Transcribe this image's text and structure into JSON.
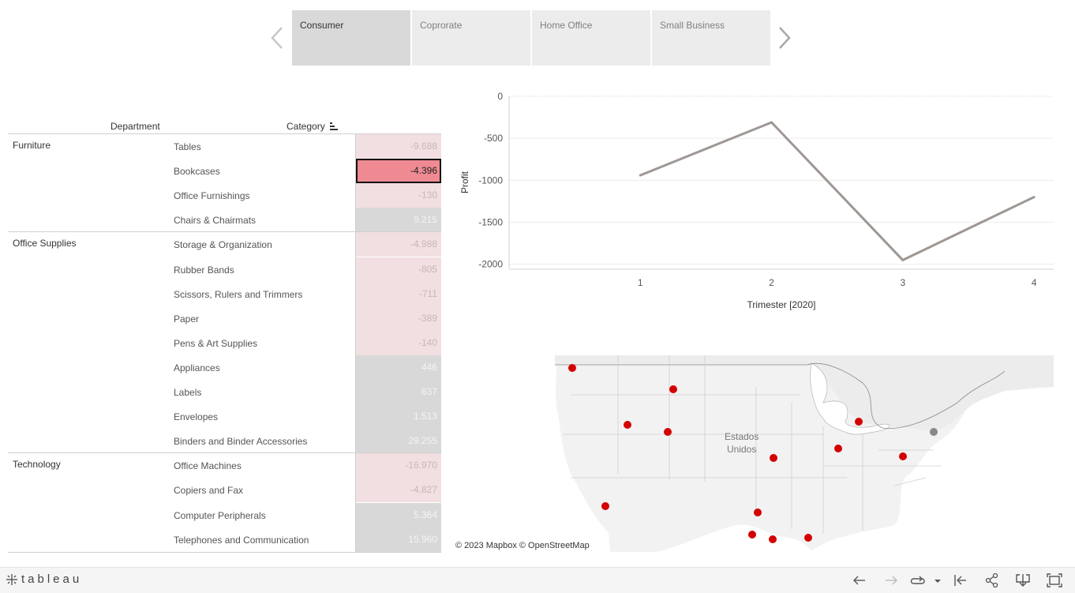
{
  "segments": {
    "items": [
      {
        "label": "Consumer",
        "active": true
      },
      {
        "label": "Coprorate",
        "active": false
      },
      {
        "label": "Home Office",
        "active": false
      },
      {
        "label": "Small Business",
        "active": false
      }
    ],
    "prev_icon": "chevron-left-icon",
    "next_icon": "chevron-right-icon"
  },
  "table": {
    "col_department": "Department",
    "col_category": "Category",
    "sort_icon": "sort-descending-icon",
    "departments": [
      {
        "name": "Furniture",
        "rows": [
          {
            "category": "Tables",
            "value": "-9.688",
            "sign": "neg"
          },
          {
            "category": "Bookcases",
            "value": "-4.396",
            "sign": "sel"
          },
          {
            "category": "Office Furnishings",
            "value": "-130",
            "sign": "neg"
          },
          {
            "category": "Chairs & Chairmats",
            "value": "9.215",
            "sign": "pos"
          }
        ]
      },
      {
        "name": "Office Supplies",
        "rows": [
          {
            "category": "Storage & Organization",
            "value": "-4.988",
            "sign": "neg"
          },
          {
            "category": "Rubber Bands",
            "value": "-805",
            "sign": "neg"
          },
          {
            "category": "Scissors, Rulers and Trimmers",
            "value": "-711",
            "sign": "neg"
          },
          {
            "category": "Paper",
            "value": "-389",
            "sign": "neg"
          },
          {
            "category": "Pens & Art Supplies",
            "value": "-140",
            "sign": "neg"
          },
          {
            "category": "Appliances",
            "value": "446",
            "sign": "pos"
          },
          {
            "category": "Labels",
            "value": "637",
            "sign": "pos"
          },
          {
            "category": "Envelopes",
            "value": "1.513",
            "sign": "pos"
          },
          {
            "category": "Binders and Binder Accessories",
            "value": "29.255",
            "sign": "pos"
          }
        ]
      },
      {
        "name": "Technology",
        "rows": [
          {
            "category": "Office Machines",
            "value": "-16.970",
            "sign": "neg"
          },
          {
            "category": "Copiers and Fax",
            "value": "-4.827",
            "sign": "neg"
          },
          {
            "category": "Computer Peripherals",
            "value": "5.364",
            "sign": "pos"
          },
          {
            "category": "Telephones and Communication",
            "value": "15.960",
            "sign": "pos"
          }
        ]
      }
    ]
  },
  "chart_data": {
    "type": "line",
    "x": [
      1,
      2,
      3,
      4
    ],
    "series": [
      {
        "values": [
          -940,
          -310,
          -1950,
          -1200
        ]
      }
    ],
    "xlabel": "Trimester [2020]",
    "ylabel": "Profit",
    "yticks": [
      0,
      -500,
      -1000,
      -1500,
      -2000
    ],
    "ylim": [
      -2050,
      0
    ],
    "grid": true,
    "line_color": "#9e9794"
  },
  "map": {
    "country_label_1": "Estados",
    "country_label_2": "Unidos",
    "attribution": "© 2023 Mapbox  © OpenStreetMap",
    "marker_color": "#d40000",
    "selected_marker_color": "#888888"
  },
  "footer": {
    "brand": "tableau",
    "brand_icon": "tableau-logo-icon",
    "buttons": [
      "undo-icon",
      "redo-icon",
      "revert-icon",
      "dropdown-icon",
      "reset-icon",
      "share-icon",
      "download-icon",
      "fullscreen-icon"
    ]
  }
}
